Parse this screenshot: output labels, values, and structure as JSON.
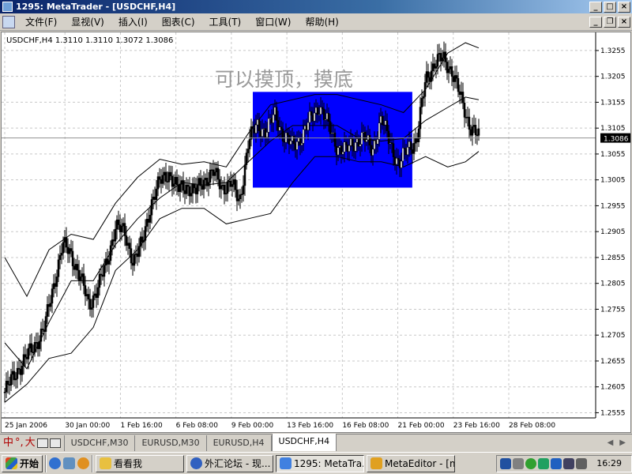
{
  "window": {
    "title": "1295: MetaTrader - [USDCHF,H4]",
    "minimize": "_",
    "maximize": "□",
    "close": "×"
  },
  "menu": [
    "文件(F)",
    "显视(V)",
    "插入(I)",
    "图表(C)",
    "工具(T)",
    "窗口(W)",
    "帮助(H)"
  ],
  "doc_buttons": {
    "minimize": "_",
    "restore": "❐",
    "close": "×"
  },
  "chart": {
    "header": "USDCHF,H4  1.3110 1.3110 1.3072 1.3086",
    "annotation": "可以摸顶，摸底",
    "current_price": "1.3086",
    "highlight_color": "#0000ff",
    "price_labels": [
      "1.3255",
      "1.3205",
      "1.3155",
      "1.3105",
      "1.3055",
      "1.3005",
      "1.2955",
      "1.2905",
      "1.2855",
      "1.2805",
      "1.2755",
      "1.2705",
      "1.2655",
      "1.2605",
      "1.2555"
    ],
    "date_labels": [
      "25 Jan 2006",
      "30 Jan 00:00",
      "1 Feb 16:00",
      "6 Feb 08:00",
      "9 Feb 00:00",
      "13 Feb 16:00",
      "16 Feb 08:00",
      "21 Feb 00:00",
      "23 Feb 16:00",
      "28 Feb 08:00"
    ]
  },
  "chart_data": {
    "type": "candlestick",
    "symbol": "USDCHF",
    "timeframe": "H4",
    "ylim": [
      1.2545,
      1.329
    ],
    "grid": true,
    "last_ohlc": {
      "open": 1.311,
      "high": 1.311,
      "low": 1.3072,
      "close": 1.3086
    },
    "price_path": [
      [
        0,
        1.2595
      ],
      [
        3,
        1.264
      ],
      [
        6,
        1.2675
      ],
      [
        9,
        1.272
      ],
      [
        11,
        1.28
      ],
      [
        13,
        1.288
      ],
      [
        15,
        1.286
      ],
      [
        17,
        1.282
      ],
      [
        19,
        1.276
      ],
      [
        21,
        1.28
      ],
      [
        23,
        1.284
      ],
      [
        25,
        1.292
      ],
      [
        27,
        1.29
      ],
      [
        29,
        1.285
      ],
      [
        31,
        1.288
      ],
      [
        33,
        1.296
      ],
      [
        35,
        1.3
      ],
      [
        37,
        1.302
      ],
      [
        39,
        1.2985
      ],
      [
        41,
        1.2995
      ],
      [
        43,
        1.298
      ],
      [
        45,
        1.3005
      ],
      [
        47,
        1.302
      ],
      [
        49,
        1.299
      ],
      [
        51,
        1.3
      ],
      [
        53,
        1.296
      ],
      [
        55,
        1.308
      ],
      [
        57,
        1.311
      ],
      [
        59,
        1.31
      ],
      [
        61,
        1.313
      ],
      [
        63,
        1.309
      ],
      [
        65,
        1.307
      ],
      [
        67,
        1.309
      ],
      [
        69,
        1.312
      ],
      [
        71,
        1.315
      ],
      [
        73,
        1.311
      ],
      [
        75,
        1.307
      ],
      [
        77,
        1.306
      ],
      [
        79,
        1.308
      ],
      [
        81,
        1.3085
      ],
      [
        83,
        1.3065
      ],
      [
        85,
        1.312
      ],
      [
        87,
        1.308
      ],
      [
        89,
        1.303
      ],
      [
        91,
        1.307
      ],
      [
        93,
        1.308
      ],
      [
        95,
        1.32
      ],
      [
        97,
        1.323
      ],
      [
        99,
        1.324
      ],
      [
        101,
        1.3215
      ],
      [
        103,
        1.316
      ],
      [
        105,
        1.311
      ],
      [
        107,
        1.3086
      ]
    ],
    "bollinger_bands": {
      "upper": [
        [
          0,
          1.2855
        ],
        [
          5,
          1.278
        ],
        [
          10,
          1.287
        ],
        [
          15,
          1.29
        ],
        [
          20,
          1.289
        ],
        [
          25,
          1.296
        ],
        [
          30,
          1.301
        ],
        [
          35,
          1.3045
        ],
        [
          40,
          1.3035
        ],
        [
          45,
          1.304
        ],
        [
          50,
          1.303
        ],
        [
          55,
          1.3095
        ],
        [
          60,
          1.315
        ],
        [
          65,
          1.316
        ],
        [
          70,
          1.317
        ],
        [
          75,
          1.317
        ],
        [
          80,
          1.316
        ],
        [
          85,
          1.315
        ],
        [
          90,
          1.3135
        ],
        [
          95,
          1.318
        ],
        [
          100,
          1.325
        ],
        [
          104,
          1.327
        ],
        [
          107,
          1.326
        ]
      ],
      "middle": [
        [
          0,
          1.269
        ],
        [
          5,
          1.264
        ],
        [
          10,
          1.273
        ],
        [
          15,
          1.281
        ],
        [
          20,
          1.281
        ],
        [
          25,
          1.288
        ],
        [
          30,
          1.293
        ],
        [
          35,
          1.297
        ],
        [
          40,
          1.3
        ],
        [
          45,
          1.2995
        ],
        [
          50,
          1.3
        ],
        [
          55,
          1.304
        ],
        [
          60,
          1.308
        ],
        [
          65,
          1.311
        ],
        [
          70,
          1.311
        ],
        [
          75,
          1.311
        ],
        [
          80,
          1.3085
        ],
        [
          85,
          1.308
        ],
        [
          90,
          1.3085
        ],
        [
          95,
          1.312
        ],
        [
          100,
          1.3145
        ],
        [
          104,
          1.3165
        ],
        [
          107,
          1.316
        ]
      ],
      "lower": [
        [
          0,
          1.2575
        ],
        [
          5,
          1.261
        ],
        [
          10,
          1.266
        ],
        [
          15,
          1.267
        ],
        [
          20,
          1.272
        ],
        [
          25,
          1.283
        ],
        [
          30,
          1.287
        ],
        [
          35,
          1.293
        ],
        [
          40,
          1.295
        ],
        [
          45,
          1.295
        ],
        [
          50,
          1.292
        ],
        [
          55,
          1.293
        ],
        [
          60,
          1.294
        ],
        [
          65,
          1.3
        ],
        [
          70,
          1.305
        ],
        [
          75,
          1.305
        ],
        [
          80,
          1.304
        ],
        [
          85,
          1.304
        ],
        [
          90,
          1.303
        ],
        [
          95,
          1.305
        ],
        [
          100,
          1.303
        ],
        [
          104,
          1.304
        ],
        [
          107,
          1.306
        ]
      ]
    },
    "highlight_zone": {
      "x0": 56,
      "x1": 92,
      "y0": 1.299,
      "y1": 1.3175
    }
  },
  "tabs": [
    {
      "label": "USDCHF,M30",
      "active": false
    },
    {
      "label": "EURUSD,M30",
      "active": false
    },
    {
      "label": "EURUSD,H4",
      "active": false
    },
    {
      "label": "USDCHF,H4",
      "active": true
    }
  ],
  "tab_tools": [
    "中",
    "°,",
    "大"
  ],
  "tab_scroll": {
    "left": "◀",
    "right": "▶"
  },
  "taskbar": {
    "start": "开始",
    "tasks": [
      {
        "label": "看看我",
        "color": "#e8c040"
      },
      {
        "label": "外汇论坛 - 现...",
        "color": "#3060c0"
      },
      {
        "label": "1295: MetaTra...",
        "color": "#4080e0",
        "active": true
      },
      {
        "label": "MetaEditor - [m...",
        "color": "#e0a020"
      }
    ],
    "clock": "16:29"
  }
}
